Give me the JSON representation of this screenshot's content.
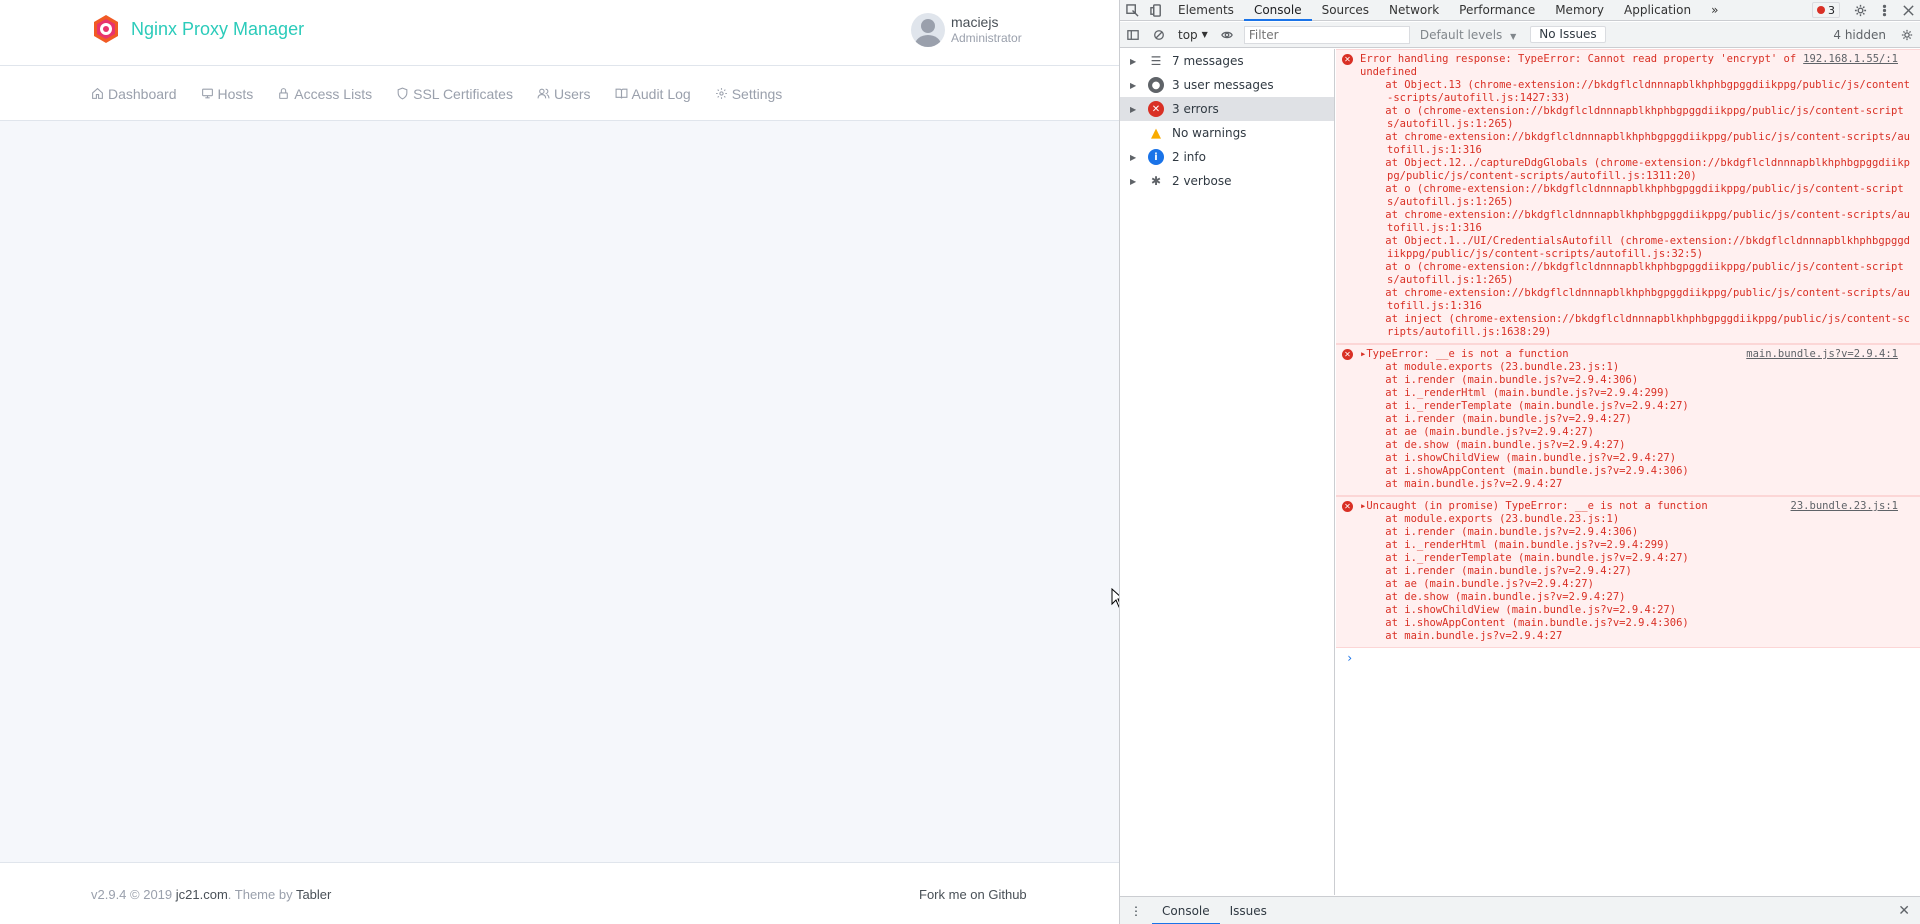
{
  "app": {
    "brand_name": "Nginx Proxy Manager",
    "brand_color": "#2bcbba",
    "user": {
      "name": "maciejs",
      "role": "Administrator"
    },
    "nav": [
      {
        "label": "Dashboard",
        "icon": "home-icon"
      },
      {
        "label": "Hosts",
        "icon": "monitor-icon"
      },
      {
        "label": "Access Lists",
        "icon": "lock-icon"
      },
      {
        "label": "SSL Certificates",
        "icon": "shield-icon"
      },
      {
        "label": "Users",
        "icon": "users-icon"
      },
      {
        "label": "Audit Log",
        "icon": "book-icon"
      },
      {
        "label": "Settings",
        "icon": "gear-icon"
      }
    ],
    "footer": {
      "version_text": "v2.9.4 © 2019 ",
      "company_link": "jc21.com",
      "theme_text": ". Theme by ",
      "theme_link": "Tabler",
      "github_link": "Fork me on Github"
    }
  },
  "devtools": {
    "tabs": [
      "Elements",
      "Console",
      "Sources",
      "Network",
      "Performance",
      "Memory",
      "Application"
    ],
    "active_tab": "Console",
    "error_count": "3",
    "context": "top",
    "filter_placeholder": "Filter",
    "default_levels": "Default levels",
    "issues_button": "No Issues",
    "hidden_count": "4 hidden",
    "sidebar": [
      {
        "label": "7 messages",
        "icon": "list-icon",
        "expandable": true
      },
      {
        "label": "3 user messages",
        "icon": "user-circle-icon",
        "expandable": true
      },
      {
        "label": "3 errors",
        "icon": "error-icon",
        "expandable": true,
        "selected": true
      },
      {
        "label": "No warnings",
        "icon": "warning-icon",
        "expandable": false
      },
      {
        "label": "2 info",
        "icon": "info-icon",
        "expandable": true
      },
      {
        "label": "2 verbose",
        "icon": "bug-icon",
        "expandable": true
      }
    ],
    "messages": [
      {
        "source": "192.168.1.55/:1",
        "head": "Error handling response: TypeError: Cannot read property 'encrypt' of undefined",
        "lines": [
          "    at Object.13 (chrome-extension://bkdgflcldnnnapblkhphbgpggdiikppg/public/js/content-scripts/autofill.js:1427:33)",
          "    at o (chrome-extension://bkdgflcldnnnapblkhphbgpggdiikppg/public/js/content-scripts/autofill.js:1:265)",
          "    at chrome-extension://bkdgflcldnnnapblkhphbgpggdiikppg/public/js/content-scripts/autofill.js:1:316",
          "    at Object.12../captureDdgGlobals (chrome-extension://bkdgflcldnnnapblkhphbgpggdiikppg/public/js/content-scripts/autofill.js:1311:20)",
          "    at o (chrome-extension://bkdgflcldnnnapblkhphbgpggdiikppg/public/js/content-scripts/autofill.js:1:265)",
          "    at chrome-extension://bkdgflcldnnnapblkhphbgpggdiikppg/public/js/content-scripts/autofill.js:1:316",
          "    at Object.1../UI/CredentialsAutofill (chrome-extension://bkdgflcldnnnapblkhphbgpggdiikppg/public/js/content-scripts/autofill.js:32:5)",
          "    at o (chrome-extension://bkdgflcldnnnapblkhphbgpggdiikppg/public/js/content-scripts/autofill.js:1:265)",
          "    at chrome-extension://bkdgflcldnnnapblkhphbgpggdiikppg/public/js/content-scripts/autofill.js:1:316",
          "    at inject (chrome-extension://bkdgflcldnnnapblkhphbgpggdiikppg/public/js/content-scripts/autofill.js:1638:29)"
        ],
        "wrap": true
      },
      {
        "source": "main.bundle.js?v=2.9.4:1",
        "head": "▸TypeError: __e is not a function",
        "lines": [
          "    at module.exports (23.bundle.23.js:1)",
          "    at i.render (main.bundle.js?v=2.9.4:306)",
          "    at i._renderHtml (main.bundle.js?v=2.9.4:299)",
          "    at i._renderTemplate (main.bundle.js?v=2.9.4:27)",
          "    at i.render (main.bundle.js?v=2.9.4:27)",
          "    at ae (main.bundle.js?v=2.9.4:27)",
          "    at de.show (main.bundle.js?v=2.9.4:27)",
          "    at i.showChildView (main.bundle.js?v=2.9.4:27)",
          "    at i.showAppContent (main.bundle.js?v=2.9.4:306)",
          "    at main.bundle.js?v=2.9.4:27"
        ],
        "wrap": false
      },
      {
        "source": "23.bundle.23.js:1",
        "head": "▸Uncaught (in promise) TypeError: __e is not a function",
        "lines": [
          "    at module.exports (23.bundle.23.js:1)",
          "    at i.render (main.bundle.js?v=2.9.4:306)",
          "    at i._renderHtml (main.bundle.js?v=2.9.4:299)",
          "    at i._renderTemplate (main.bundle.js?v=2.9.4:27)",
          "    at i.render (main.bundle.js?v=2.9.4:27)",
          "    at ae (main.bundle.js?v=2.9.4:27)",
          "    at de.show (main.bundle.js?v=2.9.4:27)",
          "    at i.showChildView (main.bundle.js?v=2.9.4:27)",
          "    at i.showAppContent (main.bundle.js?v=2.9.4:306)",
          "    at main.bundle.js?v=2.9.4:27"
        ],
        "wrap": false
      }
    ],
    "prompt_symbol": "›",
    "drawer_tabs": [
      "Console",
      "Issues"
    ],
    "close_symbol": "✕"
  }
}
